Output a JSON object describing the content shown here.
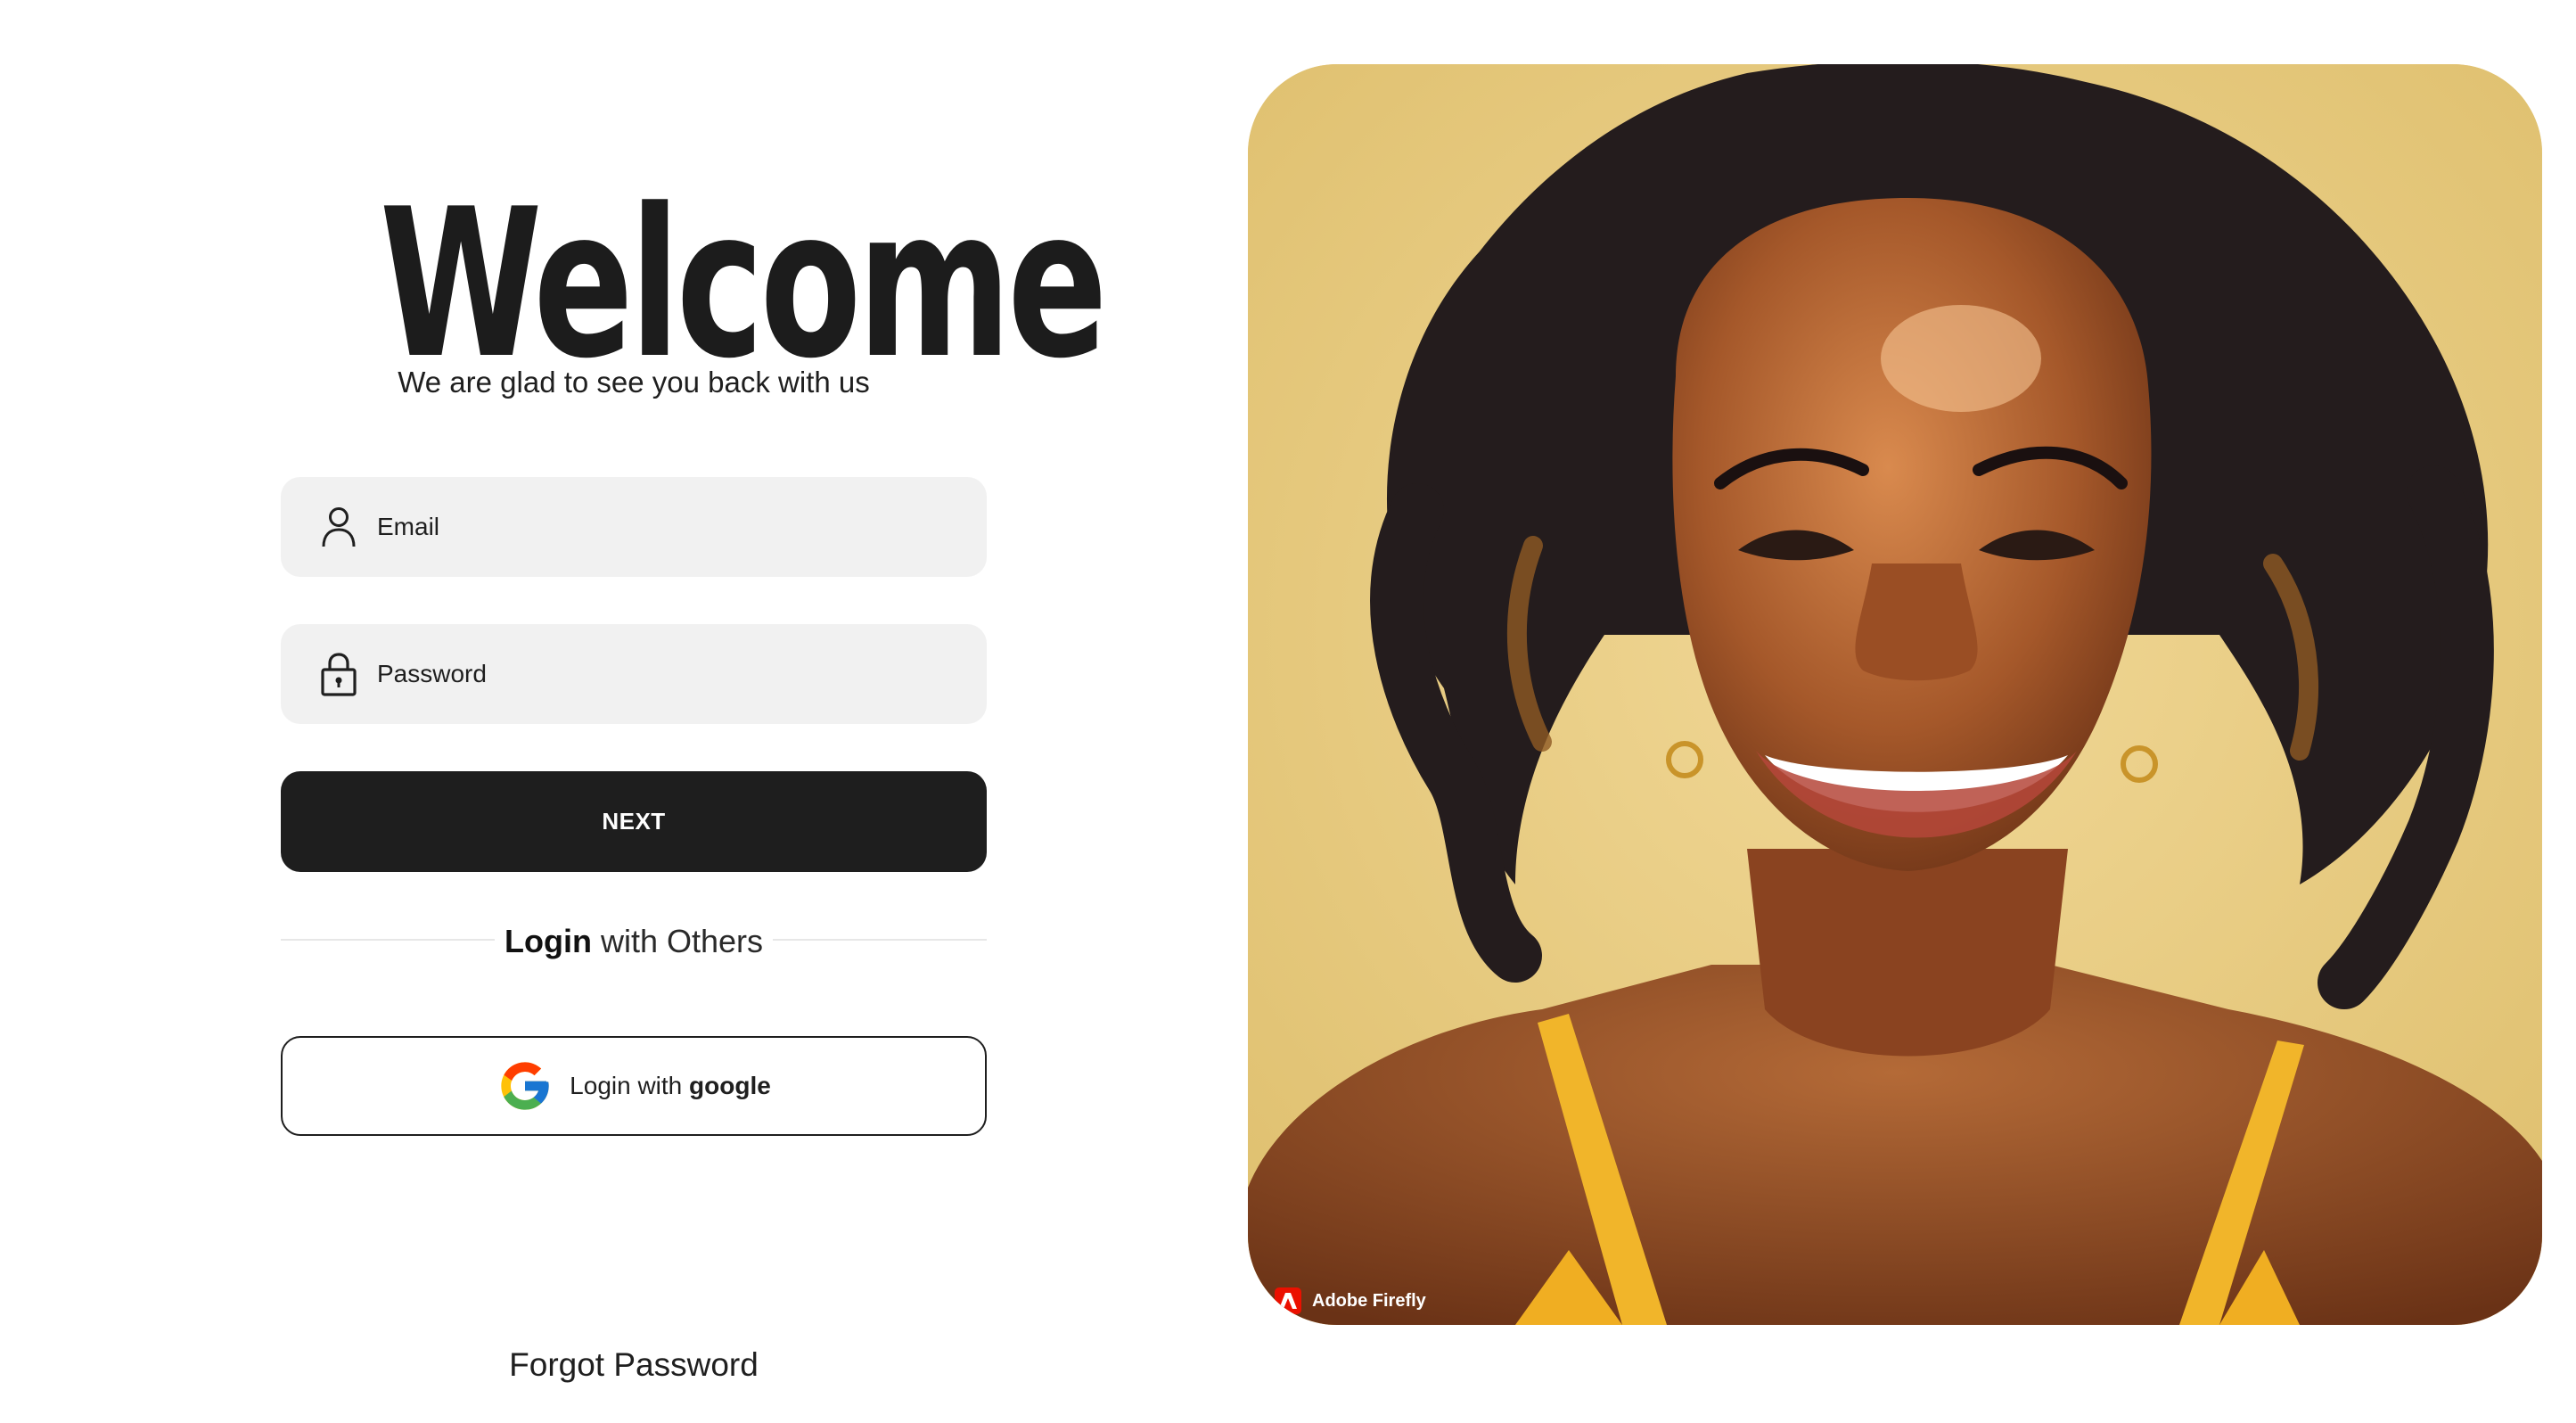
{
  "login": {
    "title": "Welcome",
    "subtitle": "We are glad to see you back with us",
    "email": {
      "placeholder": "Email",
      "icon": "user-icon"
    },
    "password": {
      "placeholder": "Password",
      "icon": "lock-icon"
    },
    "next_label": "NEXT",
    "divider": {
      "bold": "Login",
      "rest": " with Others"
    },
    "google": {
      "prefix": "Login with ",
      "bold": "google",
      "icon": "google-icon"
    },
    "forgot_label": "Forgot Password"
  },
  "hero": {
    "badge_text": "Adobe Firefly",
    "badge_icon": "adobe-icon",
    "background_color": "#e7c978"
  },
  "colors": {
    "button_dark": "#1e1e1e",
    "field_bg": "#f1f1f1",
    "text_dark": "#1c1c1c"
  }
}
